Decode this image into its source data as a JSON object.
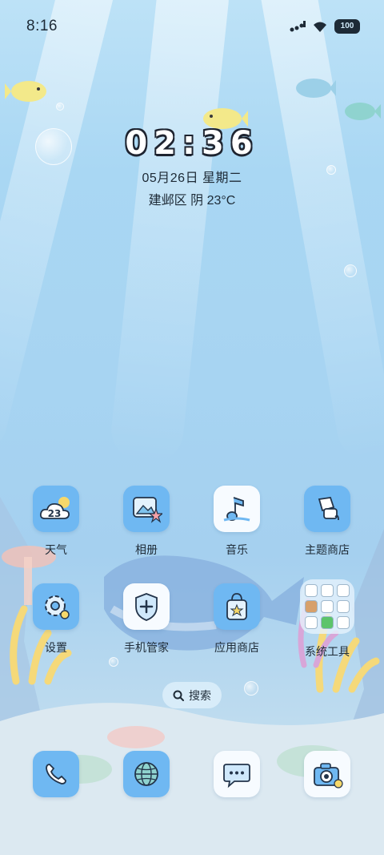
{
  "status_bar": {
    "time": "8:16",
    "battery": "100",
    "signal_icon": "signal-icon",
    "wifi_icon": "wifi-icon"
  },
  "clock_widget": {
    "time": "02:36",
    "date": "05月26日 星期二",
    "weather": "建邺区 阴 23°C"
  },
  "apps": {
    "row1": [
      {
        "label": "天气",
        "icon": "weather-icon",
        "badge": "23"
      },
      {
        "label": "相册",
        "icon": "gallery-icon"
      },
      {
        "label": "音乐",
        "icon": "music-icon"
      },
      {
        "label": "主题商店",
        "icon": "theme-store-icon"
      }
    ],
    "row2": [
      {
        "label": "设置",
        "icon": "settings-gear-icon"
      },
      {
        "label": "手机管家",
        "icon": "phone-manager-shield-icon"
      },
      {
        "label": "应用商店",
        "icon": "app-store-bag-icon"
      },
      {
        "label": "系统工具",
        "icon": "folder-icon"
      }
    ]
  },
  "search": {
    "label": "搜索",
    "icon": "search-icon"
  },
  "dock": [
    {
      "icon": "phone-icon"
    },
    {
      "icon": "browser-globe-icon"
    },
    {
      "icon": "messages-icon"
    },
    {
      "icon": "camera-icon"
    }
  ],
  "colors": {
    "tile_blue": "#6fb8f2",
    "tile_white": "#f7fbff",
    "text": "#1f2c38"
  }
}
